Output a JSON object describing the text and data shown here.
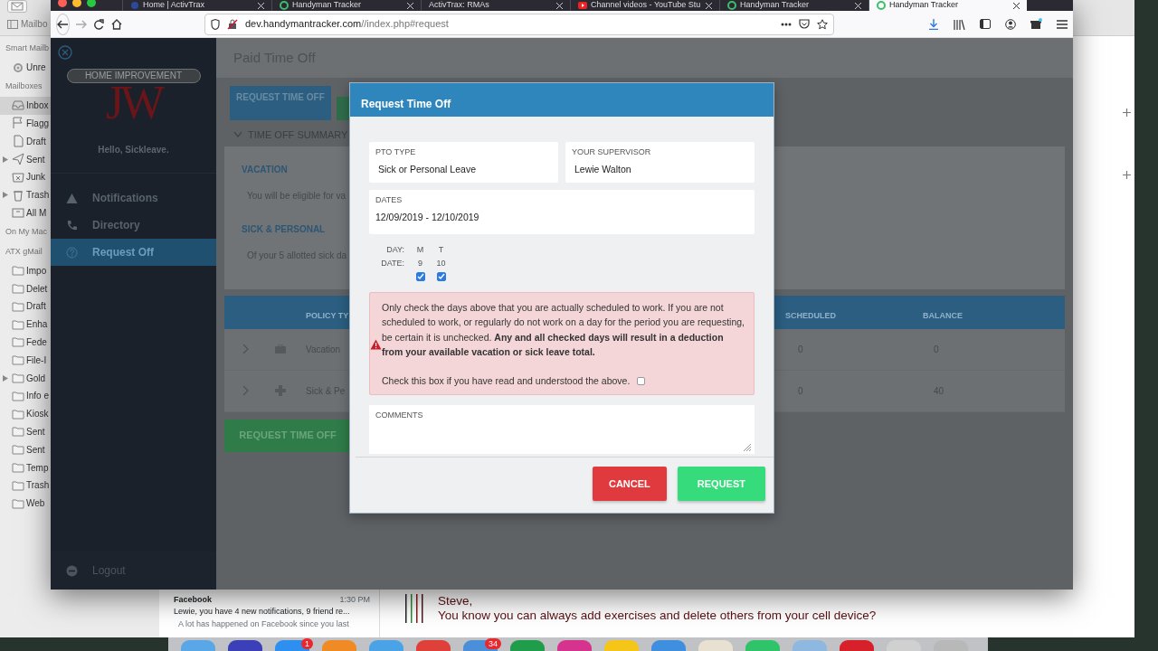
{
  "mail": {
    "toolbar_button": "Mailbo",
    "sidebar": [
      {
        "label": "Smart Mailb",
        "kind": "section",
        "selected": false,
        "expandable": false
      },
      {
        "label": "Unre",
        "kind": "smart",
        "selected": false,
        "expandable": false
      },
      {
        "label": "Mailboxes",
        "kind": "section",
        "selected": false,
        "expandable": false
      },
      {
        "label": "Inbox",
        "kind": "inbox",
        "selected": true,
        "expandable": false
      },
      {
        "label": "Flagg",
        "kind": "flagged",
        "selected": false,
        "expandable": false
      },
      {
        "label": "Draft",
        "kind": "drafts",
        "selected": false,
        "expandable": false
      },
      {
        "label": "Sent",
        "kind": "sent",
        "selected": false,
        "expandable": true
      },
      {
        "label": "Junk",
        "kind": "junk",
        "selected": false,
        "expandable": false
      },
      {
        "label": "Trash",
        "kind": "trash",
        "selected": false,
        "expandable": true
      },
      {
        "label": "All M",
        "kind": "archive",
        "selected": false,
        "expandable": false
      },
      {
        "label": "On My Mac",
        "kind": "section",
        "selected": false,
        "expandable": false
      },
      {
        "label": "ATX gMail",
        "kind": "section",
        "selected": false,
        "expandable": false
      },
      {
        "label": "Impo",
        "kind": "folder",
        "selected": false,
        "expandable": false
      },
      {
        "label": "Delet",
        "kind": "folder",
        "selected": false,
        "expandable": false
      },
      {
        "label": "Draft",
        "kind": "folder",
        "selected": false,
        "expandable": false
      },
      {
        "label": "Enha",
        "kind": "folder",
        "selected": false,
        "expandable": false
      },
      {
        "label": "Fede",
        "kind": "folder",
        "selected": false,
        "expandable": false
      },
      {
        "label": "File-I",
        "kind": "folder",
        "selected": false,
        "expandable": false
      },
      {
        "label": "Gold",
        "kind": "folder",
        "selected": false,
        "expandable": true
      },
      {
        "label": "Info e",
        "kind": "folder",
        "selected": false,
        "expandable": false
      },
      {
        "label": "Kiosk",
        "kind": "folder",
        "selected": false,
        "expandable": false
      },
      {
        "label": "Sent",
        "kind": "folder",
        "selected": false,
        "expandable": false
      },
      {
        "label": "Sent",
        "kind": "folder",
        "selected": false,
        "expandable": false
      },
      {
        "label": "Temp",
        "kind": "folder",
        "selected": false,
        "expandable": false
      },
      {
        "label": "Trash",
        "kind": "folder",
        "selected": false,
        "expandable": false
      },
      {
        "label": "Web",
        "kind": "folder",
        "selected": false,
        "expandable": false
      }
    ],
    "message": {
      "sender": "Facebook",
      "time": "1:30 PM",
      "subject": "Lewie, you have 4 new notifications, 9 friend re...",
      "preview": "A lot has happened on Facebook since you last"
    },
    "body": [
      "Steve,",
      "You know you can always add exercises and delete others from your cell device?"
    ]
  },
  "browser": {
    "tabs": [
      {
        "title": "Home | ActivTrax",
        "kind": "activtrax",
        "selected": false
      },
      {
        "title": "Handyman Tracker",
        "kind": "tracker",
        "selected": false
      },
      {
        "title": "ActivTrax: RMAs",
        "kind": "blank",
        "selected": false
      },
      {
        "title": "Channel videos - YouTube Stu",
        "kind": "youtube",
        "selected": false
      },
      {
        "title": "Handyman Tracker",
        "kind": "tracker",
        "selected": false
      },
      {
        "title": "Handyman Tracker",
        "kind": "tracker",
        "selected": true
      }
    ],
    "url_host": "dev.handymantracker.com",
    "url_path": "//index.php#request"
  },
  "app": {
    "sidebar": {
      "logo_letters": "JW",
      "logo_text": "HOME IMPROVEMENT",
      "greeting": "Hello, Sickleave.",
      "items": [
        {
          "label": "Notifications",
          "kind": "warning",
          "selected": false
        },
        {
          "label": "Directory",
          "kind": "phone",
          "selected": false
        },
        {
          "label": "Request Off",
          "kind": "question",
          "selected": true
        }
      ],
      "logout": "Logout"
    },
    "page_title": "Paid Time Off",
    "top_button": "REQUEST TIME OFF",
    "summary": {
      "title": "TIME OFF SUMMARY",
      "expanded": true,
      "sections": [
        {
          "heading": "VACATION",
          "text": "You will be eligible for va"
        },
        {
          "heading": "SICK & PERSONAL",
          "text": "Of your 5 allotted sick da"
        }
      ]
    },
    "table": {
      "columns": [
        "POLICY TY",
        "SCHEDULED",
        "BALANCE"
      ],
      "rows": [
        {
          "kind": "vacation",
          "policy": "Vacation",
          "scheduled": "0",
          "balance": "0"
        },
        {
          "kind": "sick",
          "policy": "Sick & Pe",
          "scheduled": "0",
          "balance": "40"
        }
      ]
    },
    "bottom_button": "REQUEST TIME OFF"
  },
  "modal": {
    "title": "Request Time Off",
    "fields": [
      {
        "label": "PTO TYPE",
        "value": "Sick or Personal Leave"
      },
      {
        "label": "YOUR SUPERVISOR",
        "value": "Lewie Walton"
      },
      {
        "label": "DATES",
        "value": "12/09/2019 - 12/10/2019"
      }
    ],
    "day_label": "DAY:",
    "date_label": "DATE:",
    "days": [
      {
        "day": "M",
        "date": "9",
        "checked": true
      },
      {
        "day": "T",
        "date": "10",
        "checked": true
      }
    ],
    "warning": {
      "text": "Only check the days above that you are actually scheduled to work. If you are not scheduled to work, or regularly do not work on a day for the period you are requesting, be certain it is unchecked. **Any and all checked days will result in a deduction from your available vacation or sick leave total.**",
      "confirm": "Check this box if you have read and understood the above.",
      "confirmed": false
    },
    "comments": {
      "label": "COMMENTS"
    },
    "buttons": [
      {
        "label": "CANCEL",
        "kind": "cancel"
      },
      {
        "label": "REQUEST",
        "kind": "request"
      }
    ]
  },
  "dock": [
    {
      "color": "#5aa7e8"
    },
    {
      "color": "#3b3fb8"
    },
    {
      "color": "#2d8ff0",
      "badge": "1"
    },
    {
      "color": "#f08a24"
    },
    {
      "color": "#4aa3e6"
    },
    {
      "color": "#e0403a"
    },
    {
      "color": "#4a8fd8",
      "badge": "34"
    },
    {
      "color": "#1f9d4a"
    },
    {
      "color": "#d6338f"
    },
    {
      "color": "#f5c518"
    },
    {
      "color": "#3f8fe0"
    },
    {
      "color": "#e8e0d0"
    },
    {
      "color": "#2fc46a"
    },
    {
      "color": "#8fb8e0"
    },
    {
      "color": "#d8202a"
    },
    {
      "color": "#d0d0d0"
    },
    {
      "color": "#b8b8b8"
    }
  ]
}
